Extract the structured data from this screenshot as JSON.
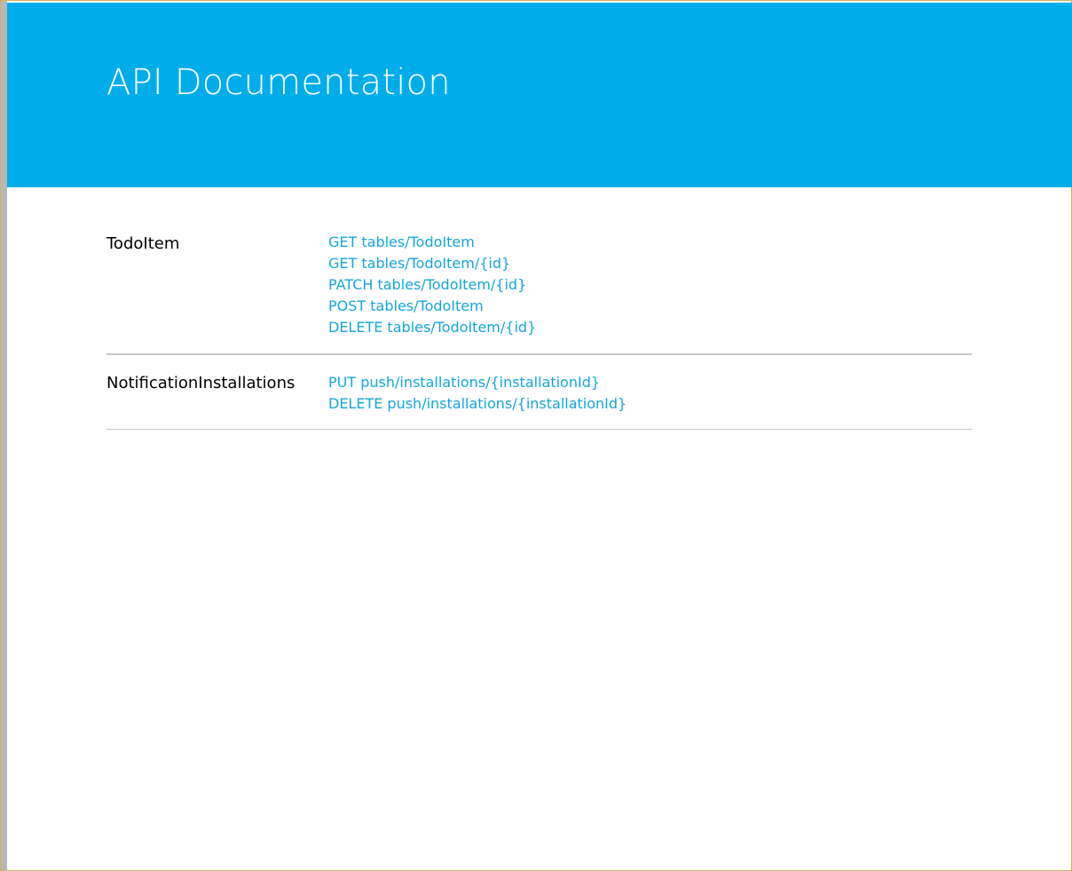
{
  "page": {
    "title": "API Documentation"
  },
  "groups": [
    {
      "name": "TodoItem",
      "endpoints": [
        "GET tables/TodoItem",
        "GET tables/TodoItem/{id}",
        "PATCH tables/TodoItem/{id}",
        "POST tables/TodoItem",
        "DELETE tables/TodoItem/{id}"
      ]
    },
    {
      "name": "NotificationInstallations",
      "endpoints": [
        "PUT push/installations/{installationId}",
        "DELETE push/installations/{installationId}"
      ]
    }
  ],
  "colors": {
    "header_background": "#00acea",
    "link": "#13a6d9",
    "divider": "#c7c7c7",
    "window_border": "#d6b25a",
    "left_gutter": "#b8b8b8"
  }
}
